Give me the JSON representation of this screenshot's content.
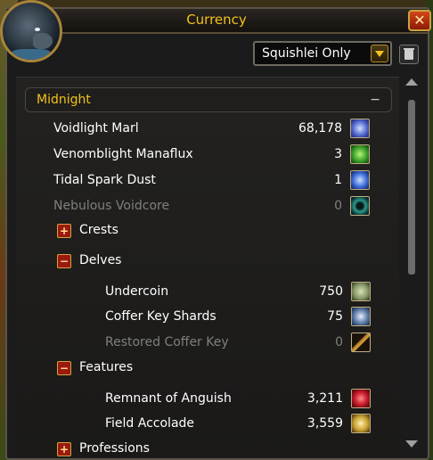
{
  "window": {
    "title": "Currency"
  },
  "filter": {
    "selected": "Squishlei Only"
  },
  "section": {
    "title": "Midnight",
    "collapse_symbol": "−"
  },
  "currencies": [
    {
      "name": "Voidlight Marl",
      "qty": "68,178",
      "icon": "voidlight-marl-icon",
      "color": "#4a5fc8"
    },
    {
      "name": "Venomblight Manaflux",
      "qty": "3",
      "icon": "venomblight-manaflux-icon",
      "color": "#3aa02a"
    },
    {
      "name": "Tidal Spark Dust",
      "qty": "1",
      "icon": "tidal-spark-dust-icon",
      "color": "#3a6ad8"
    },
    {
      "name": "Nebulous Voidcore",
      "qty": "0",
      "icon": "nebulous-voidcore-icon",
      "color": "#2a9a8a"
    }
  ],
  "categories": {
    "crests": {
      "label": "Crests",
      "toggle": "+"
    },
    "delves": {
      "label": "Delves",
      "toggle": "−"
    },
    "features": {
      "label": "Features",
      "toggle": "−"
    },
    "professions": {
      "label": "Professions",
      "toggle": "+"
    }
  },
  "delves_items": [
    {
      "name": "Undercoin",
      "qty": "750",
      "icon": "undercoin-icon",
      "color": "#8a9a6a"
    },
    {
      "name": "Coffer Key Shards",
      "qty": "75",
      "icon": "coffer-key-shards-icon",
      "color": "#5a7aa8"
    },
    {
      "name": "Restored Coffer Key",
      "qty": "0",
      "icon": "restored-coffer-key-icon",
      "color": "#b07828"
    }
  ],
  "features_items": [
    {
      "name": "Remnant of Anguish",
      "qty": "3,211",
      "icon": "remnant-of-anguish-icon",
      "color": "#c81a2a"
    },
    {
      "name": "Field Accolade",
      "qty": "3,559",
      "icon": "field-accolade-icon",
      "color": "#c8a030"
    }
  ]
}
